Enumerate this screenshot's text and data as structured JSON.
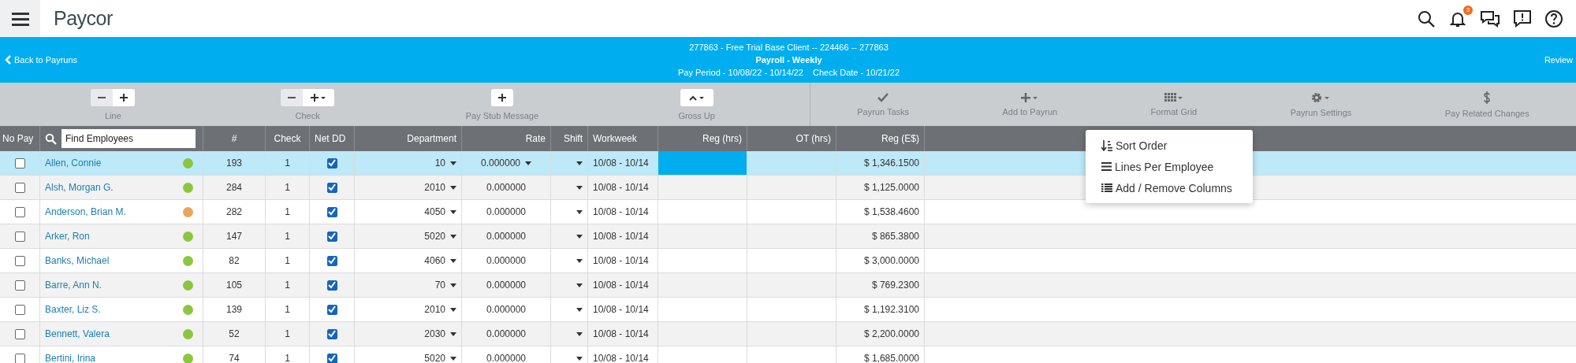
{
  "header": {
    "logo": "Paycor",
    "notification_count": "3"
  },
  "banner": {
    "back_link": "Back to Payruns",
    "client_line": "277863 - Free Trial Base Client -- 224466 -- 277863",
    "payroll_title": "Payroll - Weekly",
    "pay_period": "Pay Period - 10/08/22 - 10/14/22",
    "check_date": "Check Date - 10/21/22",
    "review_link": "Review"
  },
  "toolbar": {
    "left_groups": [
      {
        "label": "Line",
        "kind": "minus-plus"
      },
      {
        "label": "Check",
        "kind": "minus-plus-caret"
      },
      {
        "label": "Pay Stub Message",
        "kind": "plus"
      },
      {
        "label": "Gross Up",
        "kind": "caret-up"
      }
    ],
    "right_groups": [
      {
        "label": "Payrun Tasks",
        "kind": "check"
      },
      {
        "label": "Add to Payrun",
        "kind": "plus"
      },
      {
        "label": "Format Grid",
        "kind": "grid"
      },
      {
        "label": "Payrun Settings",
        "kind": "gear"
      },
      {
        "label": "Pay Related Changes",
        "kind": "dollar"
      }
    ]
  },
  "table": {
    "columns": [
      "No Pay",
      "#",
      "Check",
      "Net DD",
      "Department",
      "Rate",
      "Shift",
      "Workweek",
      "Reg (hrs)",
      "OT (hrs)",
      "Reg (E$)"
    ],
    "search": {
      "placeholder": "Find Employees"
    },
    "rows": [
      {
        "name": "Allen, Connie",
        "color": "#8cc63f",
        "number": "193",
        "check": "1",
        "no_pay": false,
        "net_dd": true,
        "department": "10",
        "rate": "0.000000",
        "workweek": "10/08 - 10/14",
        "reg_earnings": "$ 1,346.1500",
        "selected": true
      },
      {
        "name": "Alsh, Morgan G.",
        "color": "#8cc63f",
        "number": "284",
        "check": "1",
        "no_pay": false,
        "net_dd": true,
        "department": "2010",
        "rate": "0.000000",
        "workweek": "10/08 - 10/14",
        "reg_earnings": "$ 1,125.0000",
        "selected": false
      },
      {
        "name": "Anderson, Brian M.",
        "color": "#e8a65a",
        "number": "282",
        "check": "1",
        "no_pay": false,
        "net_dd": true,
        "department": "4050",
        "rate": "0.000000",
        "workweek": "10/08 - 10/14",
        "reg_earnings": "$ 1,538.4600",
        "selected": false
      },
      {
        "name": "Arker, Ron",
        "color": "#8cc63f",
        "number": "147",
        "check": "1",
        "no_pay": false,
        "net_dd": true,
        "department": "5020",
        "rate": "0.000000",
        "workweek": "10/08 - 10/14",
        "reg_earnings": "$ 865.3800",
        "selected": false
      },
      {
        "name": "Banks, Michael",
        "color": "#8cc63f",
        "number": "82",
        "check": "1",
        "no_pay": false,
        "net_dd": true,
        "department": "4060",
        "rate": "0.000000",
        "workweek": "10/08 - 10/14",
        "reg_earnings": "$ 3,000.0000",
        "selected": false
      },
      {
        "name": "Barre, Ann N.",
        "color": "#8cc63f",
        "number": "105",
        "check": "1",
        "no_pay": false,
        "net_dd": true,
        "department": "70",
        "rate": "0.000000",
        "workweek": "10/08 - 10/14",
        "reg_earnings": "$ 769.2300",
        "selected": false
      },
      {
        "name": "Baxter, Liz S.",
        "color": "#8cc63f",
        "number": "139",
        "check": "1",
        "no_pay": false,
        "net_dd": true,
        "department": "2010",
        "rate": "0.000000",
        "workweek": "10/08 - 10/14",
        "reg_earnings": "$ 1,192.3100",
        "selected": false
      },
      {
        "name": "Bennett, Valera",
        "color": "#8cc63f",
        "number": "52",
        "check": "1",
        "no_pay": false,
        "net_dd": true,
        "department": "2030",
        "rate": "0.000000",
        "workweek": "10/08 - 10/14",
        "reg_earnings": "$ 2,200.0000",
        "selected": false
      },
      {
        "name": "Bertini, Irina",
        "color": "#8cc63f",
        "number": "74",
        "check": "1",
        "no_pay": false,
        "net_dd": true,
        "department": "5020",
        "rate": "0.000000",
        "workweek": "10/08 - 10/14",
        "reg_earnings": "$ 1,685.0000",
        "selected": false
      }
    ]
  },
  "format_menu": {
    "items": [
      {
        "label": "Sort Order",
        "kind": "sort"
      },
      {
        "label": "Lines Per Employee",
        "kind": "lines"
      },
      {
        "label": "Add / Remove Columns",
        "kind": "columns"
      }
    ]
  }
}
